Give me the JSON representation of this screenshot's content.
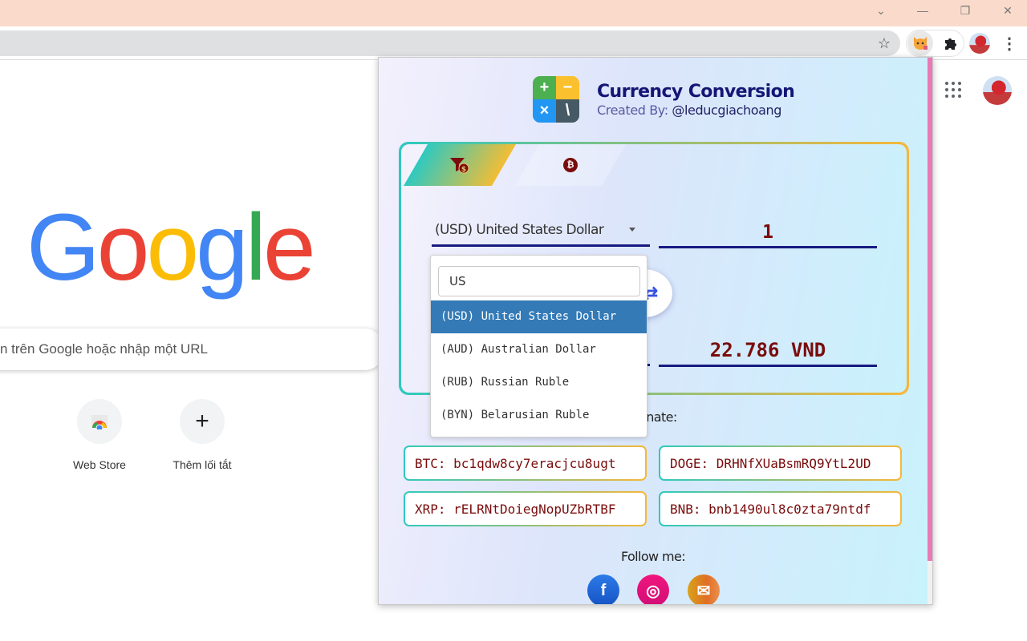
{
  "browser": {
    "window_controls": {
      "tabs_menu": "⌄",
      "minimize": "—",
      "restore": "❐",
      "close": "✕"
    },
    "toolbar": {
      "bookmark_icon": "star-icon",
      "extensions": [
        "currency-converter-extension",
        "extensions-puzzle"
      ],
      "menu_icon": "⋮"
    }
  },
  "ntp": {
    "logo_letters": [
      {
        "char": "G",
        "color": "#4285f4"
      },
      {
        "char": "o",
        "color": "#ea4335"
      },
      {
        "char": "o",
        "color": "#fbbc05"
      },
      {
        "char": "g",
        "color": "#4285f4"
      },
      {
        "char": "l",
        "color": "#34a853"
      },
      {
        "char": "e",
        "color": "#ea4335"
      }
    ],
    "search_placeholder": "n trên Google hoặc nhập một URL",
    "shortcuts": [
      {
        "label": "Web Store",
        "icon": "web-store-icon"
      },
      {
        "label": "Thêm lối tắt",
        "icon": "+"
      }
    ]
  },
  "popup": {
    "title": "Currency Conversion",
    "subtitle_prefix": "Created By:",
    "author": "@leducgiachoang",
    "logo_cells": [
      {
        "glyph": "+",
        "color": "#4caf50"
      },
      {
        "glyph": "−",
        "color": "#fbc02d"
      },
      {
        "glyph": "×",
        "color": "#2196f3"
      },
      {
        "glyph": "\\",
        "color": "#455a64"
      }
    ],
    "tabs": [
      {
        "name": "fiat",
        "icon": "funnel-dollar-icon",
        "glyph": "$",
        "active": true
      },
      {
        "name": "crypto",
        "icon": "bitcoin-icon",
        "glyph": "₿",
        "active": false
      }
    ],
    "from_currency": "(USD) United States Dollar",
    "amount": "1",
    "swap_glyph": "⇄",
    "result": "22.786 VND",
    "donate_label": "Donate:",
    "wallets": [
      {
        "label": "BTC: bc1qdw8cy7eracjcu8ugt"
      },
      {
        "label": "DOGE: DRHNfXUaBsmRQ9YtL2UD"
      },
      {
        "label": "XRP: rELRNtDoiegNopUZbRTBF"
      },
      {
        "label": "BNB: bnb1490ul8c0zta79ntdf"
      }
    ],
    "follow_label": "Follow me:",
    "social": [
      {
        "name": "facebook",
        "glyph": "f"
      },
      {
        "name": "instagram",
        "glyph": "◎"
      },
      {
        "name": "email",
        "glyph": "✉"
      }
    ]
  },
  "dropdown": {
    "search_value": "US",
    "options": [
      {
        "label": "(USD) United States Dollar",
        "selected": true
      },
      {
        "label": "(AUD) Australian Dollar",
        "selected": false
      },
      {
        "label": "(RUB) Russian Ruble",
        "selected": false
      },
      {
        "label": "(BYN) Belarusian Ruble",
        "selected": false
      }
    ]
  },
  "colors": {
    "titlebar": "#fadbcb",
    "accent_navy": "#161a80",
    "value_red": "#7a0c0c",
    "dropdown_selected": "#337ab7",
    "scroll_thumb": "#e97ab4"
  }
}
